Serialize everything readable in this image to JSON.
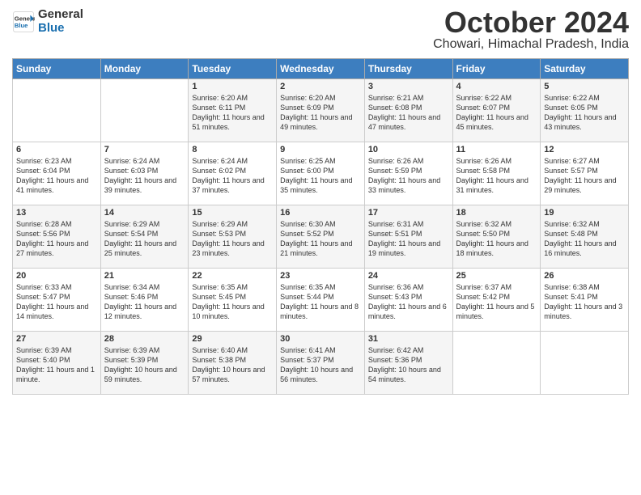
{
  "logo": {
    "line1": "General",
    "line2": "Blue"
  },
  "header": {
    "month": "October 2024",
    "location": "Chowari, Himachal Pradesh, India"
  },
  "weekdays": [
    "Sunday",
    "Monday",
    "Tuesday",
    "Wednesday",
    "Thursday",
    "Friday",
    "Saturday"
  ],
  "weeks": [
    [
      {
        "day": "",
        "sunrise": "",
        "sunset": "",
        "daylight": ""
      },
      {
        "day": "",
        "sunrise": "",
        "sunset": "",
        "daylight": ""
      },
      {
        "day": "1",
        "sunrise": "Sunrise: 6:20 AM",
        "sunset": "Sunset: 6:11 PM",
        "daylight": "Daylight: 11 hours and 51 minutes."
      },
      {
        "day": "2",
        "sunrise": "Sunrise: 6:20 AM",
        "sunset": "Sunset: 6:09 PM",
        "daylight": "Daylight: 11 hours and 49 minutes."
      },
      {
        "day": "3",
        "sunrise": "Sunrise: 6:21 AM",
        "sunset": "Sunset: 6:08 PM",
        "daylight": "Daylight: 11 hours and 47 minutes."
      },
      {
        "day": "4",
        "sunrise": "Sunrise: 6:22 AM",
        "sunset": "Sunset: 6:07 PM",
        "daylight": "Daylight: 11 hours and 45 minutes."
      },
      {
        "day": "5",
        "sunrise": "Sunrise: 6:22 AM",
        "sunset": "Sunset: 6:05 PM",
        "daylight": "Daylight: 11 hours and 43 minutes."
      }
    ],
    [
      {
        "day": "6",
        "sunrise": "Sunrise: 6:23 AM",
        "sunset": "Sunset: 6:04 PM",
        "daylight": "Daylight: 11 hours and 41 minutes."
      },
      {
        "day": "7",
        "sunrise": "Sunrise: 6:24 AM",
        "sunset": "Sunset: 6:03 PM",
        "daylight": "Daylight: 11 hours and 39 minutes."
      },
      {
        "day": "8",
        "sunrise": "Sunrise: 6:24 AM",
        "sunset": "Sunset: 6:02 PM",
        "daylight": "Daylight: 11 hours and 37 minutes."
      },
      {
        "day": "9",
        "sunrise": "Sunrise: 6:25 AM",
        "sunset": "Sunset: 6:00 PM",
        "daylight": "Daylight: 11 hours and 35 minutes."
      },
      {
        "day": "10",
        "sunrise": "Sunrise: 6:26 AM",
        "sunset": "Sunset: 5:59 PM",
        "daylight": "Daylight: 11 hours and 33 minutes."
      },
      {
        "day": "11",
        "sunrise": "Sunrise: 6:26 AM",
        "sunset": "Sunset: 5:58 PM",
        "daylight": "Daylight: 11 hours and 31 minutes."
      },
      {
        "day": "12",
        "sunrise": "Sunrise: 6:27 AM",
        "sunset": "Sunset: 5:57 PM",
        "daylight": "Daylight: 11 hours and 29 minutes."
      }
    ],
    [
      {
        "day": "13",
        "sunrise": "Sunrise: 6:28 AM",
        "sunset": "Sunset: 5:56 PM",
        "daylight": "Daylight: 11 hours and 27 minutes."
      },
      {
        "day": "14",
        "sunrise": "Sunrise: 6:29 AM",
        "sunset": "Sunset: 5:54 PM",
        "daylight": "Daylight: 11 hours and 25 minutes."
      },
      {
        "day": "15",
        "sunrise": "Sunrise: 6:29 AM",
        "sunset": "Sunset: 5:53 PM",
        "daylight": "Daylight: 11 hours and 23 minutes."
      },
      {
        "day": "16",
        "sunrise": "Sunrise: 6:30 AM",
        "sunset": "Sunset: 5:52 PM",
        "daylight": "Daylight: 11 hours and 21 minutes."
      },
      {
        "day": "17",
        "sunrise": "Sunrise: 6:31 AM",
        "sunset": "Sunset: 5:51 PM",
        "daylight": "Daylight: 11 hours and 19 minutes."
      },
      {
        "day": "18",
        "sunrise": "Sunrise: 6:32 AM",
        "sunset": "Sunset: 5:50 PM",
        "daylight": "Daylight: 11 hours and 18 minutes."
      },
      {
        "day": "19",
        "sunrise": "Sunrise: 6:32 AM",
        "sunset": "Sunset: 5:48 PM",
        "daylight": "Daylight: 11 hours and 16 minutes."
      }
    ],
    [
      {
        "day": "20",
        "sunrise": "Sunrise: 6:33 AM",
        "sunset": "Sunset: 5:47 PM",
        "daylight": "Daylight: 11 hours and 14 minutes."
      },
      {
        "day": "21",
        "sunrise": "Sunrise: 6:34 AM",
        "sunset": "Sunset: 5:46 PM",
        "daylight": "Daylight: 11 hours and 12 minutes."
      },
      {
        "day": "22",
        "sunrise": "Sunrise: 6:35 AM",
        "sunset": "Sunset: 5:45 PM",
        "daylight": "Daylight: 11 hours and 10 minutes."
      },
      {
        "day": "23",
        "sunrise": "Sunrise: 6:35 AM",
        "sunset": "Sunset: 5:44 PM",
        "daylight": "Daylight: 11 hours and 8 minutes."
      },
      {
        "day": "24",
        "sunrise": "Sunrise: 6:36 AM",
        "sunset": "Sunset: 5:43 PM",
        "daylight": "Daylight: 11 hours and 6 minutes."
      },
      {
        "day": "25",
        "sunrise": "Sunrise: 6:37 AM",
        "sunset": "Sunset: 5:42 PM",
        "daylight": "Daylight: 11 hours and 5 minutes."
      },
      {
        "day": "26",
        "sunrise": "Sunrise: 6:38 AM",
        "sunset": "Sunset: 5:41 PM",
        "daylight": "Daylight: 11 hours and 3 minutes."
      }
    ],
    [
      {
        "day": "27",
        "sunrise": "Sunrise: 6:39 AM",
        "sunset": "Sunset: 5:40 PM",
        "daylight": "Daylight: 11 hours and 1 minute."
      },
      {
        "day": "28",
        "sunrise": "Sunrise: 6:39 AM",
        "sunset": "Sunset: 5:39 PM",
        "daylight": "Daylight: 10 hours and 59 minutes."
      },
      {
        "day": "29",
        "sunrise": "Sunrise: 6:40 AM",
        "sunset": "Sunset: 5:38 PM",
        "daylight": "Daylight: 10 hours and 57 minutes."
      },
      {
        "day": "30",
        "sunrise": "Sunrise: 6:41 AM",
        "sunset": "Sunset: 5:37 PM",
        "daylight": "Daylight: 10 hours and 56 minutes."
      },
      {
        "day": "31",
        "sunrise": "Sunrise: 6:42 AM",
        "sunset": "Sunset: 5:36 PM",
        "daylight": "Daylight: 10 hours and 54 minutes."
      },
      {
        "day": "",
        "sunrise": "",
        "sunset": "",
        "daylight": ""
      },
      {
        "day": "",
        "sunrise": "",
        "sunset": "",
        "daylight": ""
      }
    ]
  ]
}
